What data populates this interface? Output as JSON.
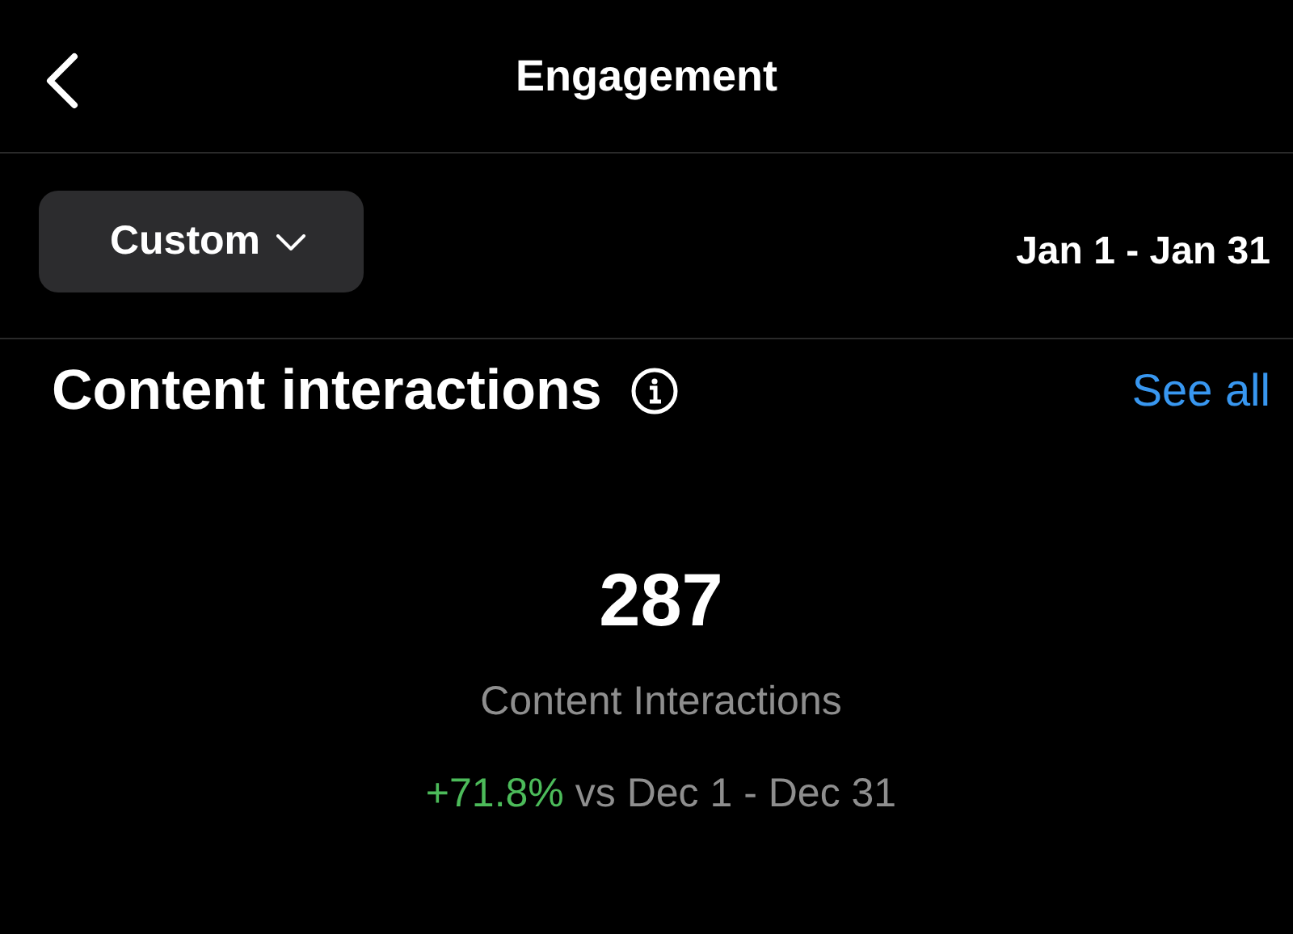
{
  "header": {
    "title": "Engagement"
  },
  "filter": {
    "label": "Custom",
    "date_range": "Jan 1 - Jan 31"
  },
  "section": {
    "title": "Content interactions",
    "link": "See all"
  },
  "metric": {
    "value": "287",
    "label": "Content Interactions",
    "change": "+71.8%",
    "comparison": "vs Dec 1 - Dec 31"
  }
}
